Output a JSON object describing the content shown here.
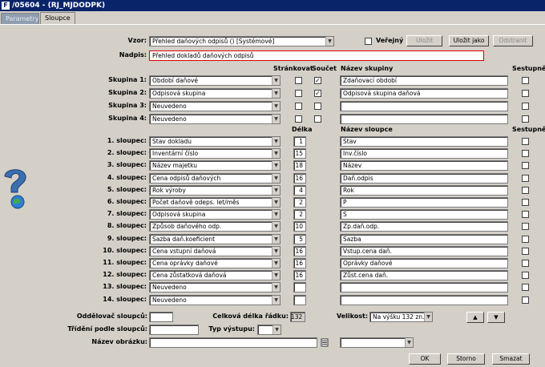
{
  "window": {
    "title": "/05604 - (RJ_MJDODPK)"
  },
  "tabs": [
    "Parametry",
    "Sloupce"
  ],
  "top": {
    "vzor_label": "Vzor:",
    "vzor_value": "Přehled daňových odpisů  ()  [Systémové]",
    "verejny_label": "Veřejný",
    "ulozit": "Uložit",
    "ulozit_jako": "Uložit jako",
    "odstranit": "Odstranit",
    "nadpis_label": "Nadpis:",
    "nadpis_value": "Přehled dokladů daňových odpisů"
  },
  "groups_header": {
    "strankovat": "Stránkovat",
    "soucet": "Součet",
    "nazev_skupiny": "Název skupiny",
    "sestupne": "Sestupně"
  },
  "groups": [
    {
      "label": "Skupina 1:",
      "value": "Období daňové",
      "strankovat": false,
      "soucet": true,
      "name": "Zdaňovací období"
    },
    {
      "label": "Skupina 2:",
      "value": "Odpisová skupina",
      "strankovat": false,
      "soucet": true,
      "name": "Odpisová skupina daňová"
    },
    {
      "label": "Skupina 3:",
      "value": "Neuvedeno",
      "strankovat": false,
      "soucet": false,
      "name": ""
    },
    {
      "label": "Skupina 4:",
      "value": "Neuvedeno",
      "strankovat": false,
      "soucet": false,
      "name": ""
    }
  ],
  "columns_header": {
    "delka": "Délka",
    "nazev_sloupce": "Název sloupce",
    "sestupne": "Sestupně"
  },
  "columns": [
    {
      "label": "1. sloupec:",
      "value": "Stav dokladu",
      "len": "1",
      "name": "Stav"
    },
    {
      "label": "2. sloupec:",
      "value": "Inventární číslo",
      "len": "15",
      "name": "Inv.číslo"
    },
    {
      "label": "3. sloupec:",
      "value": "Název majetku",
      "len": "18",
      "name": "Název"
    },
    {
      "label": "4. sloupec:",
      "value": "Cena odpisů daňových",
      "len": "16",
      "name": "Daň.odpis"
    },
    {
      "label": "5. sloupec:",
      "value": "Rok výroby",
      "len": "4",
      "name": "Rok"
    },
    {
      "label": "6. sloupec:",
      "value": "Počet daňově odeps. let/měs",
      "len": "2",
      "name": "P"
    },
    {
      "label": "7. sloupec:",
      "value": "Odpisová skupina",
      "len": "2",
      "name": "S"
    },
    {
      "label": "8. sloupec:",
      "value": "Způsob daňového odp.",
      "len": "10",
      "name": "Zp.daň.odp."
    },
    {
      "label": "9. sloupec:",
      "value": "Sazba daň.koeficient",
      "len": "5",
      "name": "Sazba"
    },
    {
      "label": "10. sloupec:",
      "value": "Cena vstupní daňová",
      "len": "16",
      "name": "Vstup.cena daň."
    },
    {
      "label": "11. sloupec:",
      "value": "Cena oprávky daňové",
      "len": "16",
      "name": "Oprávky daňové"
    },
    {
      "label": "12. sloupec:",
      "value": "Cena zůstatková daňová",
      "len": "16",
      "name": "Zůst.cena daň."
    },
    {
      "label": "13. sloupec:",
      "value": "Neuvedeno",
      "len": "",
      "name": ""
    },
    {
      "label": "14. sloupec:",
      "value": "Neuvedeno",
      "len": "",
      "name": ""
    }
  ],
  "bottom": {
    "oddelovac_label": "Oddělovač sloupců:",
    "celkova_label": "Celková délka řádku:",
    "celkova_value": "132",
    "velikost_label": "Velikost:",
    "velikost_value": "Na výšku 132 zn.",
    "trideni_label": "Třídění podle sloupců:",
    "typ_label": "Typ výstupu:",
    "obrazek_label": "Název obrázku:",
    "ok": "OK",
    "storno": "Storno",
    "smazat": "Smazat"
  }
}
